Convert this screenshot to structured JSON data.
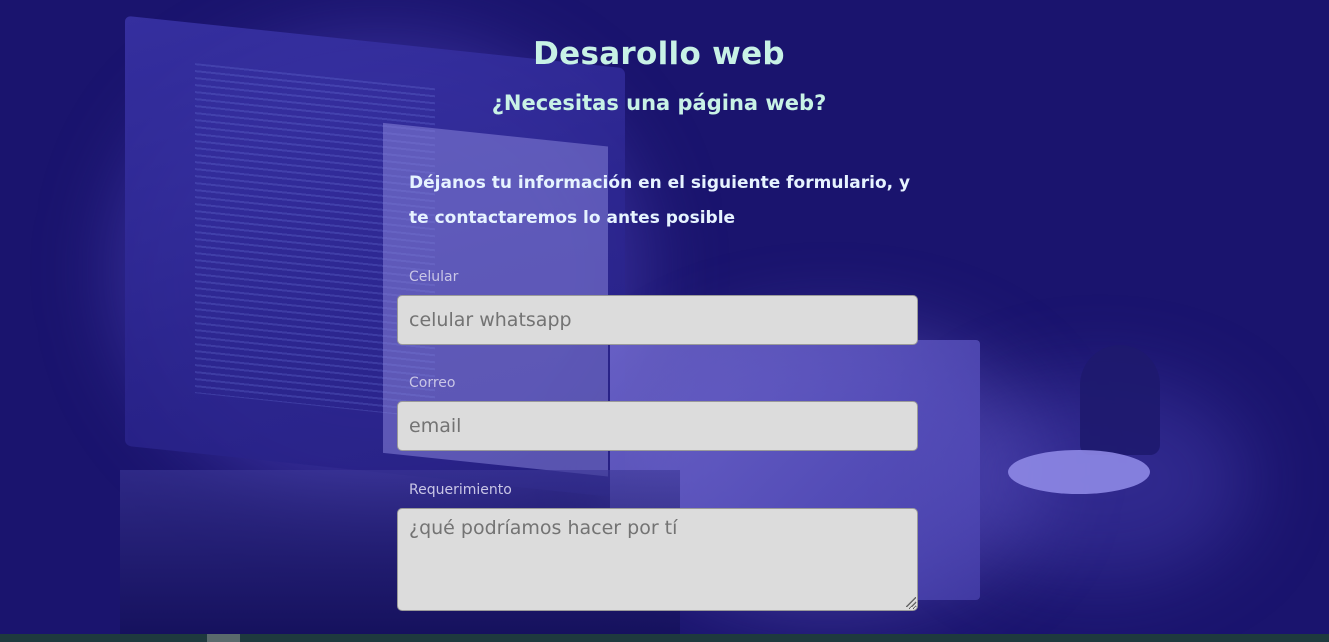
{
  "header": {
    "title": "Desarollo web",
    "subtitle": "¿Necesitas una página web?"
  },
  "intro": {
    "text": "Déjanos tu información en el siguiente formulario, y te contactaremos lo antes posible"
  },
  "form": {
    "celular": {
      "label": "Celular",
      "placeholder": "celular whatsapp"
    },
    "correo": {
      "label": "Correo",
      "placeholder": "email"
    },
    "requerimiento": {
      "label": "Requerimiento",
      "placeholder": "¿qué podríamos hacer por tí"
    }
  },
  "colors": {
    "background": "#1a146e",
    "heading": "#c8f2e6",
    "input_bg": "#dcdcdc"
  }
}
